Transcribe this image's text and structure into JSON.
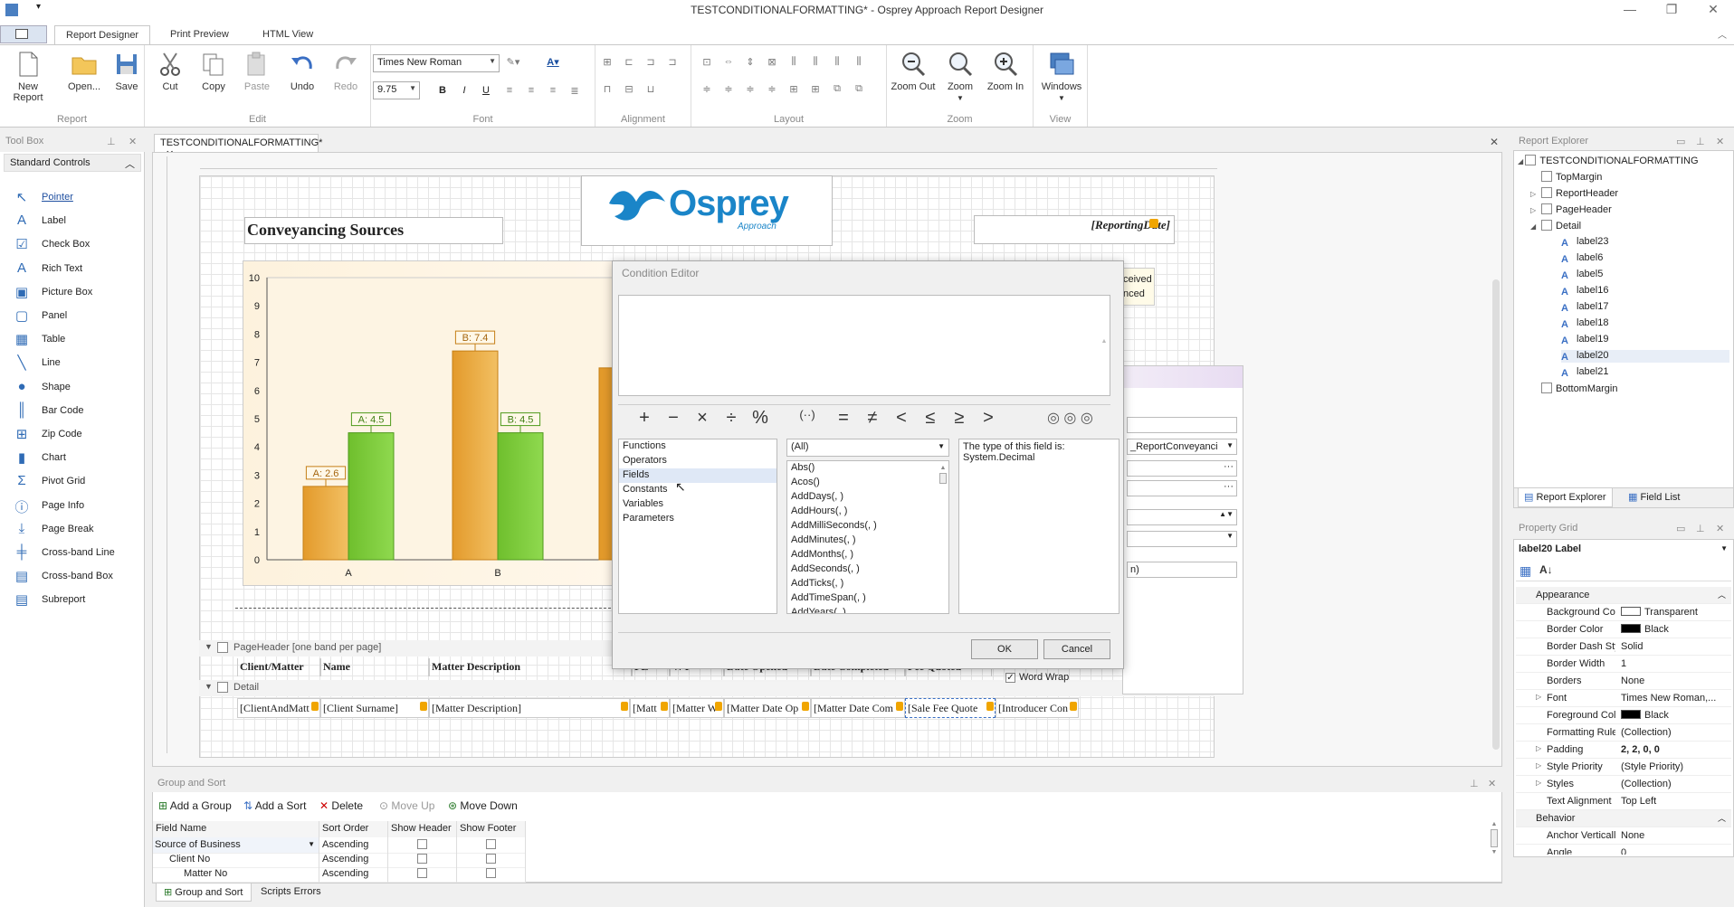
{
  "window": {
    "title": "TESTCONDITIONALFORMATTING* - Osprey Approach Report Designer"
  },
  "ribbon_tabs": [
    "Report Designer",
    "Print Preview",
    "HTML View"
  ],
  "ribbon": {
    "report": {
      "label": "Report",
      "new": "New Report",
      "open": "Open...",
      "save": "Save"
    },
    "edit": {
      "label": "Edit",
      "cut": "Cut",
      "copy": "Copy",
      "paste": "Paste",
      "undo": "Undo",
      "redo": "Redo"
    },
    "font": {
      "label": "Font",
      "family": "Times New Roman",
      "size": "9.75",
      "bold": "B",
      "italic": "I",
      "underline": "U"
    },
    "alignment": {
      "label": "Alignment"
    },
    "layout": {
      "label": "Layout"
    },
    "zoom": {
      "label": "Zoom",
      "out": "Zoom Out",
      "zoom": "Zoom",
      "in": "Zoom In"
    },
    "view": {
      "label": "View",
      "windows": "Windows"
    }
  },
  "toolbox": {
    "title": "Tool Box",
    "section": "Standard Controls",
    "items": [
      "Pointer",
      "Label",
      "Check Box",
      "Rich Text",
      "Picture Box",
      "Panel",
      "Table",
      "Line",
      "Shape",
      "Bar Code",
      "Zip Code",
      "Chart",
      "Pivot Grid",
      "Page Info",
      "Page Break",
      "Cross-band Line",
      "Cross-band Box",
      "Subreport"
    ]
  },
  "document_tab": "TESTCONDITIONALFORMATTING*",
  "report": {
    "title": "Conveyancing Sources",
    "logo_text": "Osprey",
    "logo_sub": "Approach",
    "reporting_date": "[ReportingDate]",
    "side_text_1": "ceived",
    "side_text_2": "nced",
    "page_header_band": "PageHeader [one band per page]",
    "detail_band": "Detail",
    "columns": [
      "Client/Matter",
      "Name",
      "Matter Description",
      "FE",
      "WT",
      "Date Opened",
      "Date Completed",
      "Fee Quoted"
    ],
    "detail_fields": [
      "[ClientAndMatt",
      "[Client Surname]",
      "[Matter Description]",
      "[Matt",
      "[Matter W",
      "[Matter Date Op",
      "[Matter Date Com",
      "[Sale Fee Quote",
      "[Introducer Con"
    ]
  },
  "chart_data": {
    "type": "bar",
    "categories": [
      "A",
      "B"
    ],
    "series": [
      {
        "values": [
          2.6,
          7.4
        ],
        "labels": [
          "A: 2.6",
          "B: 7.4"
        ],
        "color": "#e39a2b"
      },
      {
        "values": [
          4.5,
          4.5
        ],
        "labels": [
          "A: 4.5",
          "B: 4.5"
        ],
        "color": "#6fbf2d"
      }
    ],
    "ylim": [
      0,
      10
    ],
    "yticks": [
      "0",
      "1",
      "2",
      "3",
      "4",
      "5",
      "6",
      "7",
      "8",
      "9",
      "10"
    ]
  },
  "condition_editor": {
    "title": "Condition Editor",
    "operators": [
      "+",
      "−",
      "×",
      "÷",
      "%",
      "(··)",
      "=",
      "≠",
      "<",
      "≤",
      "≥",
      ">"
    ],
    "categories": [
      "Functions",
      "Operators",
      "Fields",
      "Constants",
      "Variables",
      "Parameters"
    ],
    "filter": "(All)",
    "functions": [
      "Abs()",
      "Acos()",
      "AddDays(, )",
      "AddHours(, )",
      "AddMilliSeconds(, )",
      "AddMinutes(, )",
      "AddMonths(, )",
      "AddSeconds(, )",
      "AddTicks(, )",
      "AddTimeSpan(, )",
      "AddYears(, )"
    ],
    "description": "The type of this field is: System.Decimal",
    "ok": "OK",
    "cancel": "Cancel"
  },
  "behind_dialog": {
    "datasource": "_ReportConveyanci",
    "word_wrap": "Word Wrap",
    "text_1": "n)"
  },
  "report_explorer": {
    "title": "Report Explorer",
    "root": "TESTCONDITIONALFORMATTING",
    "nodes": [
      "TopMargin",
      "ReportHeader",
      "PageHeader",
      "Detail"
    ],
    "detail_children": [
      "label23",
      "label6",
      "label5",
      "label16",
      "label17",
      "label18",
      "label19",
      "label20",
      "label21"
    ],
    "bottom": "BottomMargin",
    "tab1": "Report Explorer",
    "tab2": "Field List"
  },
  "property_grid": {
    "title": "Property Grid",
    "selected": "label20 Label",
    "rows": [
      {
        "k": "Appearance",
        "v": "",
        "cat": true
      },
      {
        "k": "Background Col",
        "v": "Transparent",
        "swatch": "#ffffff"
      },
      {
        "k": "Border Color",
        "v": "Black",
        "swatch": "#000000"
      },
      {
        "k": "Border Dash Sty",
        "v": "Solid"
      },
      {
        "k": "Border Width",
        "v": "1"
      },
      {
        "k": "Borders",
        "v": "None"
      },
      {
        "k": "Font",
        "v": "Times New Roman,...",
        "exp": true
      },
      {
        "k": "Foreground Col",
        "v": "Black",
        "swatch": "#000000"
      },
      {
        "k": "Formatting Rule",
        "v": "(Collection)"
      },
      {
        "k": "Padding",
        "v": "2, 2, 0, 0",
        "exp": true,
        "bold": true
      },
      {
        "k": "Style Priority",
        "v": "(Style Priority)",
        "exp": true
      },
      {
        "k": "Styles",
        "v": "(Collection)",
        "exp": true
      },
      {
        "k": "Text Alignment",
        "v": "Top Left"
      },
      {
        "k": "Behavior",
        "v": "",
        "cat": true
      },
      {
        "k": "Anchor Verticall",
        "v": "None"
      },
      {
        "k": "Angle",
        "v": "0"
      }
    ]
  },
  "group_sort": {
    "title": "Group and Sort",
    "add_group": "Add a Group",
    "add_sort": "Add a Sort",
    "delete": "Delete",
    "move_up": "Move Up",
    "move_down": "Move Down",
    "columns": [
      "Field Name",
      "Sort Order",
      "Show Header",
      "Show Footer"
    ],
    "rows": [
      {
        "field": "Source of Business",
        "order": "Ascending"
      },
      {
        "field": "Client No",
        "order": "Ascending"
      },
      {
        "field": "Matter No",
        "order": "Ascending"
      }
    ],
    "bottom_tabs": [
      "Group and Sort",
      "Scripts Errors"
    ]
  }
}
